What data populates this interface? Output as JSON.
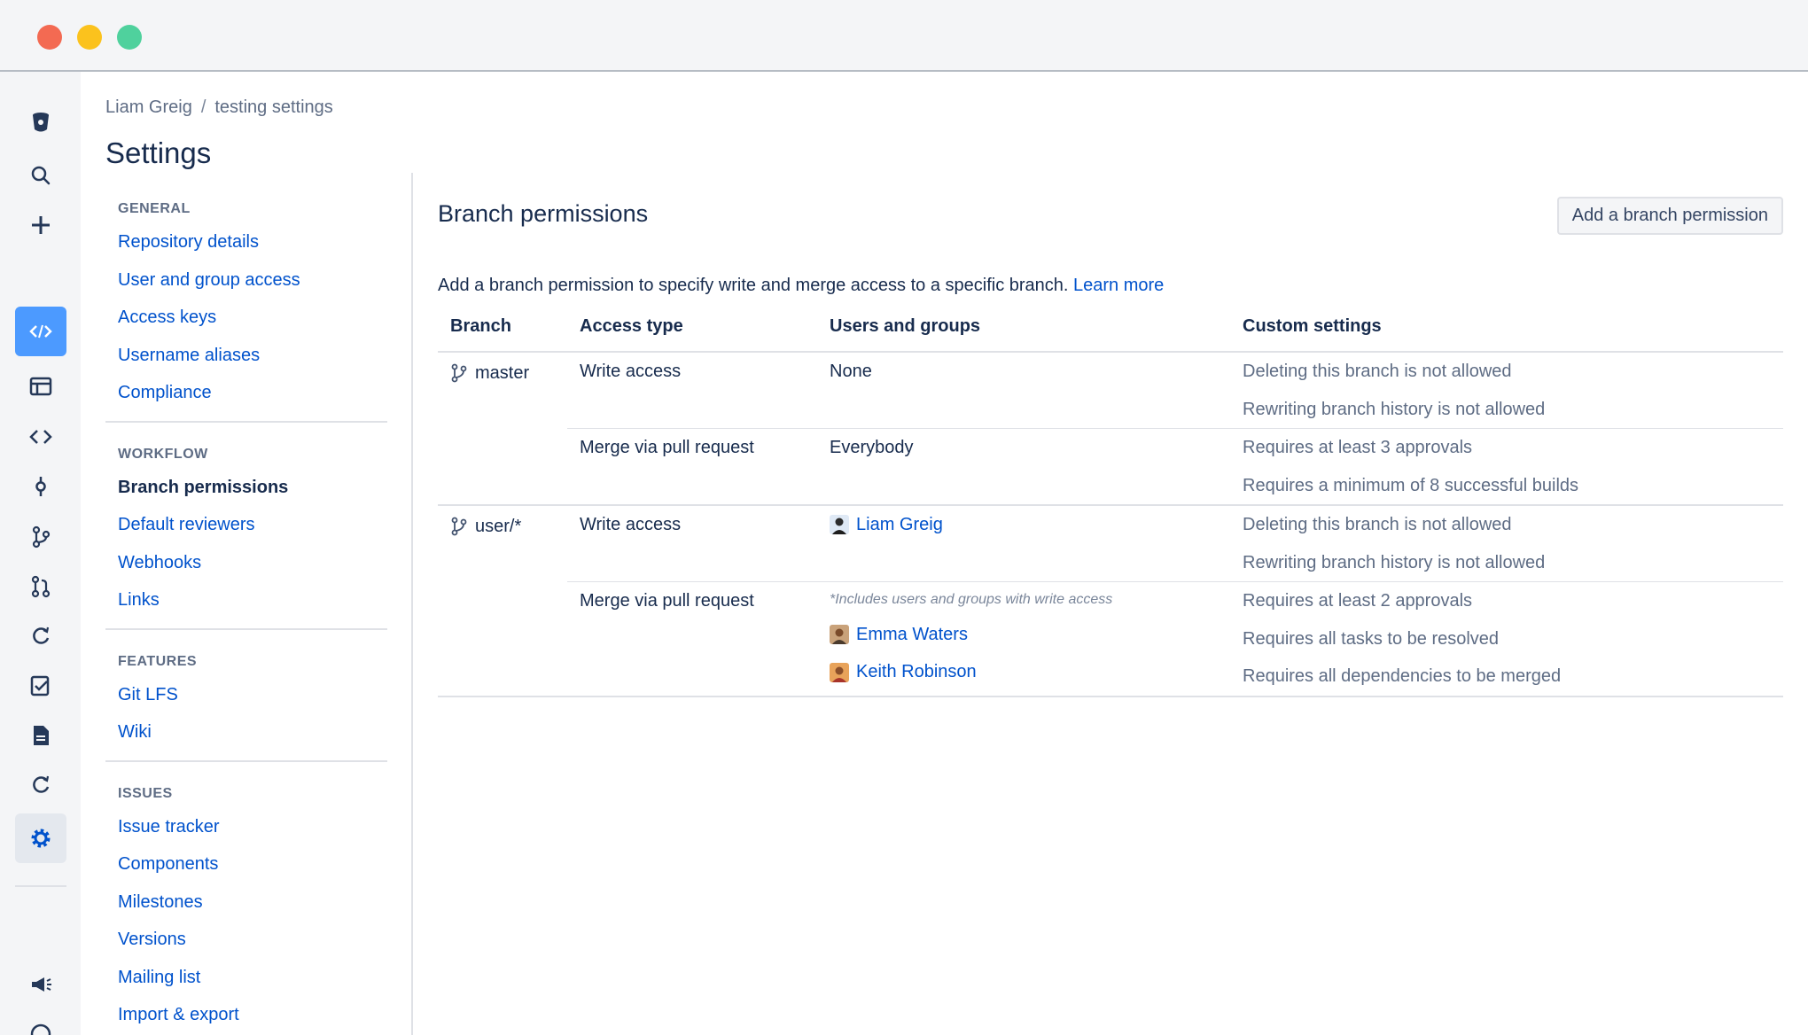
{
  "breadcrumb": {
    "owner": "Liam Greig",
    "separator": "/",
    "repo": "testing settings"
  },
  "page_title": "Settings",
  "subnav": {
    "general": {
      "heading": "GENERAL",
      "items": [
        "Repository details",
        "User and group access",
        "Access keys",
        "Username aliases",
        "Compliance"
      ]
    },
    "workflow": {
      "heading": "WORKFLOW",
      "items": [
        "Branch permissions",
        "Default reviewers",
        "Webhooks",
        "Links"
      ]
    },
    "features": {
      "heading": "FEATURES",
      "items": [
        "Git LFS",
        "Wiki"
      ]
    },
    "issues": {
      "heading": "ISSUES",
      "items": [
        "Issue tracker",
        "Components",
        "Milestones",
        "Versions",
        "Mailing list",
        "Import & export"
      ]
    }
  },
  "main": {
    "title": "Branch permissions",
    "add_button": "Add a branch permission",
    "description": "Add a branch permission to specify write and merge access to a specific branch.",
    "learn_more": "Learn more",
    "columns": {
      "branch": "Branch",
      "access": "Access type",
      "users": "Users and groups",
      "custom": "Custom settings"
    },
    "rules": [
      {
        "branch": "master",
        "write": {
          "access": "Write access",
          "users": "None",
          "settings": [
            "Deleting this branch is not allowed",
            "Rewriting branch history is not allowed"
          ]
        },
        "merge": {
          "access": "Merge via pull request",
          "users": "Everybody",
          "settings": [
            "Requires at least 3 approvals",
            "Requires a minimum of 8 successful builds"
          ]
        }
      },
      {
        "branch": "user/*",
        "write": {
          "access": "Write access",
          "user_name": "Liam Greig",
          "settings": [
            "Deleting this branch is not allowed",
            "Rewriting branch history is not allowed"
          ]
        },
        "merge": {
          "access": "Merge via pull request",
          "hint": "*Includes users and groups with write access",
          "users": [
            "Emma Waters",
            "Keith Robinson"
          ],
          "settings": [
            "Requires at least 2 approvals",
            "Requires all tasks to be resolved",
            "Requires all dependencies to be merged"
          ]
        }
      }
    ]
  },
  "colors": {
    "link": "#0052cc",
    "text": "#172b4d",
    "muted": "#5e6c84",
    "accent": "#4c9aff",
    "rail_bg": "#f4f5f7"
  }
}
